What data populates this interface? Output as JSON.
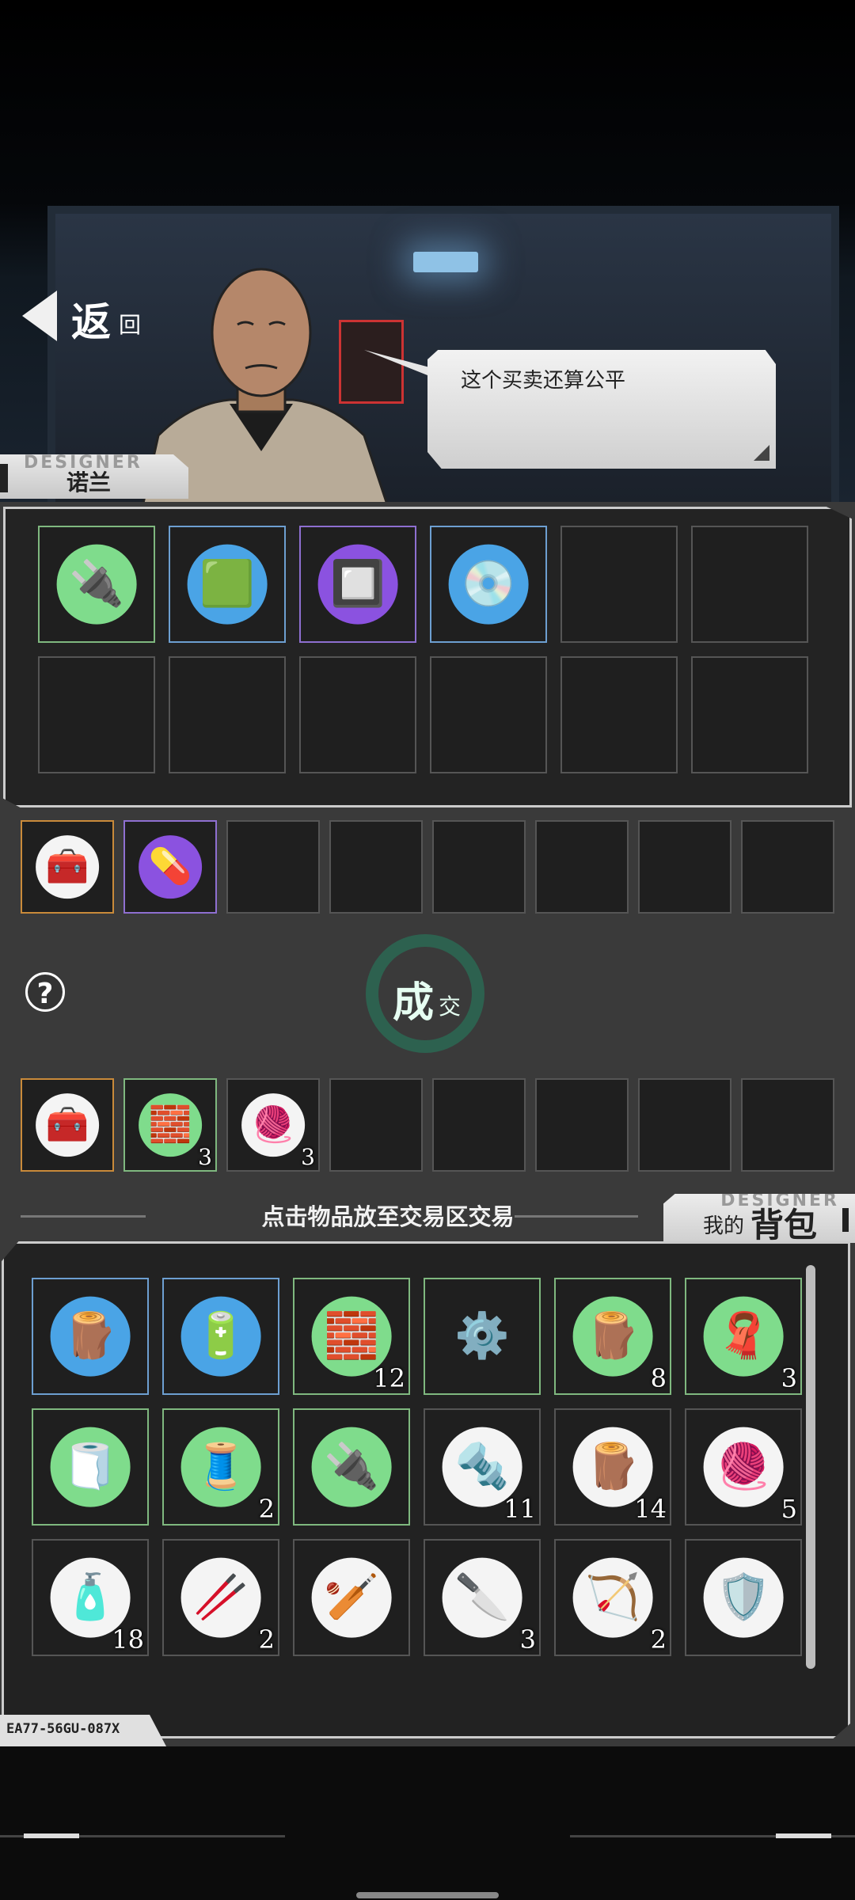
{
  "nav": {
    "back_big": "返",
    "back_small": "回"
  },
  "npc": {
    "name": "诺兰",
    "tab_watermark": "DESIGNER",
    "dialogue": "这个买卖还算公平"
  },
  "npc_stock": [
    {
      "icon": "electronic-components-icon",
      "glyph": "🔌",
      "rarity": "green",
      "bg": "g"
    },
    {
      "icon": "circuit-board-icon",
      "glyph": "🟩",
      "rarity": "blue",
      "bg": "b"
    },
    {
      "icon": "cpu-chip-icon",
      "glyph": "🔲",
      "rarity": "purple",
      "bg": "p"
    },
    {
      "icon": "hologram-disc-icon",
      "glyph": "💿",
      "rarity": "blue",
      "bg": "b"
    },
    {},
    {},
    {},
    {},
    {},
    {},
    {},
    {}
  ],
  "npc_offer": [
    {
      "icon": "first-aid-kit-icon",
      "glyph": "🧰",
      "rarity": "orange",
      "bg": "w"
    },
    {
      "icon": "medicine-bottle-icon",
      "glyph": "💊",
      "rarity": "purple",
      "bg": "p"
    },
    {},
    {},
    {},
    {},
    {},
    {}
  ],
  "deal": {
    "big": "成",
    "small": "交"
  },
  "help_label": "?",
  "player_offer": [
    {
      "icon": "first-aid-kit-icon",
      "glyph": "🧰",
      "rarity": "orange",
      "bg": "w"
    },
    {
      "icon": "metal-ingot-icon",
      "glyph": "🧱",
      "rarity": "green",
      "bg": "g",
      "count": "3"
    },
    {
      "icon": "cloth-scraps-icon",
      "glyph": "🧶",
      "rarity": "",
      "bg": "w",
      "count": "3"
    },
    {},
    {},
    {},
    {},
    {}
  ],
  "hint": "点击物品放至交易区交易",
  "bag": {
    "small": "我的",
    "big": "背包",
    "watermark": "DESIGNER"
  },
  "bag_items": [
    {
      "icon": "wood-planks-icon",
      "glyph": "🪵",
      "rarity": "blue",
      "bg": "b"
    },
    {
      "icon": "battery-icon",
      "glyph": "🔋",
      "rarity": "blue",
      "bg": "b"
    },
    {
      "icon": "metal-ingot-icon",
      "glyph": "🧱",
      "rarity": "green",
      "bg": "g",
      "count": "12"
    },
    {
      "icon": "gears-icon",
      "glyph": "⚙️",
      "rarity": "green",
      "bg": ""
    },
    {
      "icon": "lumber-icon",
      "glyph": "🪵",
      "rarity": "green",
      "bg": "g",
      "count": "8"
    },
    {
      "icon": "cloth-roll-icon",
      "glyph": "🧣",
      "rarity": "green",
      "bg": "g",
      "count": "3"
    },
    {
      "icon": "tape-roll-icon",
      "glyph": "🧻",
      "rarity": "green",
      "bg": "g"
    },
    {
      "icon": "wires-icon",
      "glyph": "🧵",
      "rarity": "green",
      "bg": "g",
      "count": "2"
    },
    {
      "icon": "electronic-components-icon",
      "glyph": "🔌",
      "rarity": "green",
      "bg": "g"
    },
    {
      "icon": "scrap-metal-icon",
      "glyph": "🔩",
      "rarity": "",
      "bg": "w",
      "count": "11"
    },
    {
      "icon": "wood-scraps-icon",
      "glyph": "🪵",
      "rarity": "",
      "bg": "w",
      "count": "14"
    },
    {
      "icon": "cloth-scraps-icon",
      "glyph": "🧶",
      "rarity": "",
      "bg": "w",
      "count": "5"
    },
    {
      "icon": "glue-bottle-icon",
      "glyph": "🧴",
      "rarity": "",
      "bg": "w",
      "count": "18"
    },
    {
      "icon": "wooden-stick-icon",
      "glyph": "🥢",
      "rarity": "",
      "bg": "w",
      "count": "2"
    },
    {
      "icon": "baseball-bat-icon",
      "glyph": "🏏",
      "rarity": "",
      "bg": "w"
    },
    {
      "icon": "knife-icon",
      "glyph": "🔪",
      "rarity": "",
      "bg": "w",
      "count": "3"
    },
    {
      "icon": "bow-icon",
      "glyph": "🏹",
      "rarity": "",
      "bg": "w",
      "count": "2"
    },
    {
      "icon": "wooden-shield-icon",
      "glyph": "🛡️",
      "rarity": "",
      "bg": "w"
    }
  ],
  "device_code": "EA77-56GU-087X"
}
